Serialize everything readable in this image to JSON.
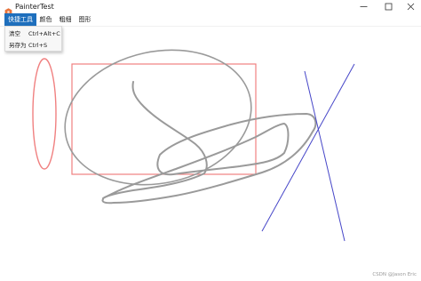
{
  "window": {
    "title": "PainterTest",
    "icon": "orange-hexagon-icon",
    "controls": [
      "minimize-icon",
      "maximize-icon",
      "close-icon"
    ]
  },
  "menubar": {
    "items": [
      {
        "label": "快捷工具",
        "active": true
      },
      {
        "label": "颜色",
        "active": false
      },
      {
        "label": "粗细",
        "active": false
      },
      {
        "label": "图形",
        "active": false
      }
    ]
  },
  "dropdown": {
    "items": [
      {
        "label": "清空",
        "shortcut": "Ctrl+Alt+C"
      },
      {
        "label": "另存为",
        "shortcut": "Ctrl+S"
      }
    ]
  },
  "canvas": {
    "background": "#ffffff",
    "shapes": [
      {
        "kind": "ellipse",
        "stroke": "#f08080"
      },
      {
        "kind": "rectangle",
        "stroke": "#f08080"
      },
      {
        "kind": "ellipse",
        "stroke": "#9a9a9a"
      },
      {
        "kind": "freehand",
        "stroke": "#9a9a9a"
      },
      {
        "kind": "line",
        "stroke": "#4646c8"
      },
      {
        "kind": "line",
        "stroke": "#4646c8"
      }
    ]
  },
  "watermark": "CSDN @Jason Eric",
  "colors": {
    "menu_active_bg": "#1e6fbd",
    "menu_active_text": "#ffffff",
    "red_pen": "#f08080",
    "gray_pen": "#9a9a9a",
    "blue_pen": "#4646c8",
    "icon_orange": "#e8743b"
  }
}
